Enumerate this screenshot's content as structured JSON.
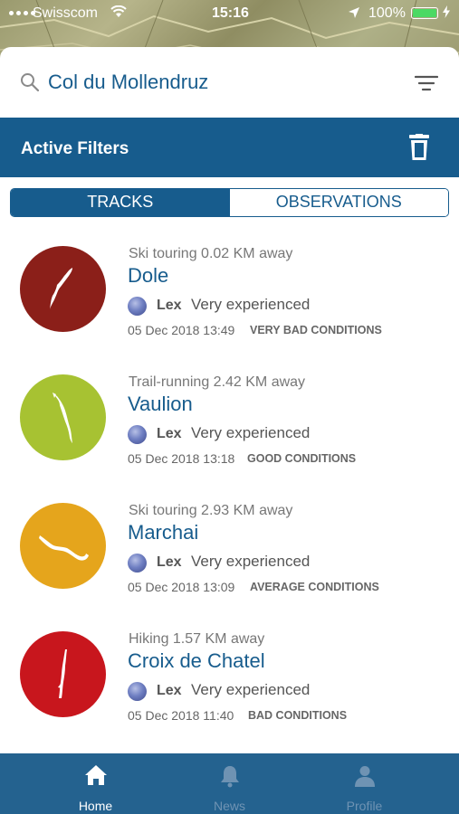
{
  "status_bar": {
    "carrier": "Swisscom",
    "time": "15:16",
    "battery": "100%"
  },
  "search": {
    "query": "Col du Mollendruz"
  },
  "filters": {
    "title": "Active Filters"
  },
  "segments": {
    "tracks": "TRACKS",
    "observations": "OBSERVATIONS",
    "active": "tracks"
  },
  "tracks": [
    {
      "meta": "Ski touring 0.02 KM away",
      "name": "Dole",
      "user": "Lex",
      "level": "Very experienced",
      "date": "05 Dec 2018 13:49",
      "condition": "VERY BAD CONDITIONS",
      "color": "#8b1f19"
    },
    {
      "meta": "Trail-running 2.42 KM away",
      "name": "Vaulion",
      "user": "Lex",
      "level": "Very experienced",
      "date": "05 Dec 2018 13:18",
      "condition": "GOOD CONDITIONS",
      "color": "#a7c232"
    },
    {
      "meta": "Ski touring 2.93 KM away",
      "name": "Marchai",
      "user": "Lex",
      "level": "Very experienced",
      "date": "05 Dec 2018 13:09",
      "condition": "AVERAGE CONDITIONS",
      "color": "#e5a51c"
    },
    {
      "meta": "Hiking 1.57 KM away",
      "name": "Croix de Chatel",
      "user": "Lex",
      "level": "Very experienced",
      "date": "05 Dec 2018 11:40",
      "condition": "BAD CONDITIONS",
      "color": "#c8161d"
    }
  ],
  "tab_bar": {
    "home": "Home",
    "news": "News",
    "profile": "Profile",
    "active": "home"
  },
  "colors": {
    "primary": "#175c8d",
    "tab_bar": "#24628f"
  },
  "icons": {
    "search": "search-icon",
    "filter": "filter-icon",
    "trash": "trash-icon",
    "home": "home-icon",
    "news": "bell-icon",
    "profile": "person-icon"
  }
}
